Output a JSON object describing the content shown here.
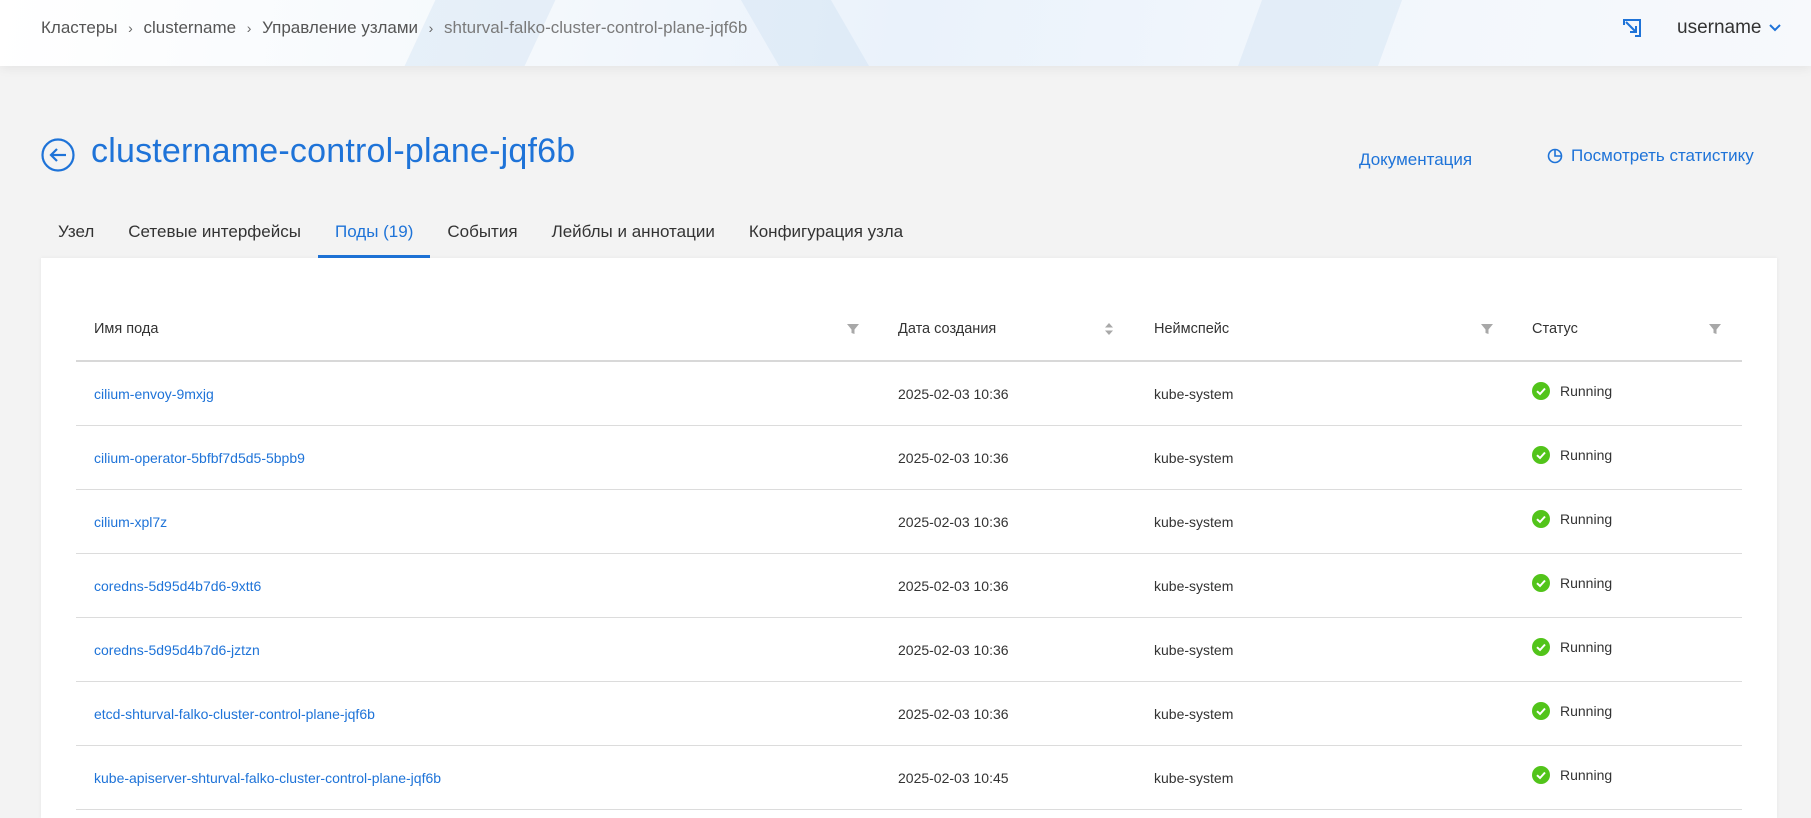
{
  "breadcrumb": [
    {
      "label": "Кластеры"
    },
    {
      "label": "clustername"
    },
    {
      "label": "Управление узлами"
    },
    {
      "label": "shturval-falko-cluster-control-plane-jqf6b"
    }
  ],
  "header": {
    "username": "username",
    "export_icon": "open-in-new-icon"
  },
  "page": {
    "title": "clustername-control-plane-jqf6b",
    "docs_link": "Документация",
    "stats_link": "Посмотреть статистику"
  },
  "tabs": [
    {
      "label": "Узел",
      "active": false
    },
    {
      "label": "Сетевые интерфейсы",
      "active": false
    },
    {
      "label": "Поды (19)",
      "active": true
    },
    {
      "label": "События",
      "active": false
    },
    {
      "label": "Лейблы и аннотации",
      "active": false
    },
    {
      "label": "Конфигурация узла",
      "active": false
    }
  ],
  "table": {
    "columns": [
      "Имя пода",
      "Дата создания",
      "Неймспейс",
      "Статус"
    ],
    "rows": [
      {
        "name": "cilium-envoy-9mxjg",
        "created": "2025-02-03 10:36",
        "namespace": "kube-system",
        "status": "Running"
      },
      {
        "name": "cilium-operator-5bfbf7d5d5-5bpb9",
        "created": "2025-02-03 10:36",
        "namespace": "kube-system",
        "status": "Running"
      },
      {
        "name": "cilium-xpl7z",
        "created": "2025-02-03 10:36",
        "namespace": "kube-system",
        "status": "Running"
      },
      {
        "name": "coredns-5d95d4b7d6-9xtt6",
        "created": "2025-02-03 10:36",
        "namespace": "kube-system",
        "status": "Running"
      },
      {
        "name": "coredns-5d95d4b7d6-jztzn",
        "created": "2025-02-03 10:36",
        "namespace": "kube-system",
        "status": "Running"
      },
      {
        "name": "etcd-shturval-falko-cluster-control-plane-jqf6b",
        "created": "2025-02-03 10:36",
        "namespace": "kube-system",
        "status": "Running"
      },
      {
        "name": "kube-apiserver-shturval-falko-cluster-control-plane-jqf6b",
        "created": "2025-02-03 10:45",
        "namespace": "kube-system",
        "status": "Running"
      }
    ]
  },
  "colors": {
    "accent": "#1e73d8",
    "status_ok": "#52c41a",
    "background": "#f3f3f3"
  }
}
